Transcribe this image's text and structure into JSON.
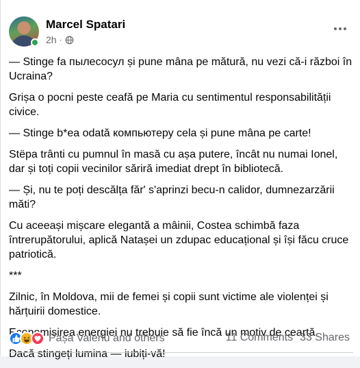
{
  "post": {
    "author": "Marcel Spatari",
    "time": "2h",
    "time_separator": "·",
    "paragraphs": [
      "— Stinge fa пылесосул și pune mâna pe mătură, nu vezi că-i război în Ucraina?",
      "Grișa o pocni peste ceafă pe Maria cu sentimentul responsabilității civice.",
      "— Stinge b*ea odată компьютеру cela și pune mâna pe carte!",
      "Stëpa trânti cu pumnul în masă cu așa putere, încât nu numai Ionel, dar și toți copii vecinilor săriră imediat drept în bibliotecă.",
      "— Și, nu te poți descălța făr' s'aprinzi becu-n calidor, dumnezarzării măti?",
      "Cu aceeași mișcare elegantă a mâinii, Costea schimbă faza întrerupătorului, aplică Natașei un zdupac educațional și își făcu cruce patriotică.",
      "***",
      "Zilnic, în Moldova, mii de femei și copii sunt victime ale violenței și hărțuirii domestice.",
      "Economisirea energiei nu trebuie să fie încă un motiv de ceartă.",
      "Dacă stingeți lumina — iubiți-vă!"
    ]
  },
  "footer": {
    "reactions": [
      "like-icon",
      "haha-icon",
      "love-icon"
    ],
    "reacted_by": "Pașa Valeriu and others",
    "comments": "11 Comments",
    "shares": "33 Shares"
  },
  "colors": {
    "text": "#050505",
    "secondary": "#65676b",
    "like": "#1877f2",
    "haha": "#f7b125",
    "love": "#f33e58",
    "online": "#31a24c"
  }
}
